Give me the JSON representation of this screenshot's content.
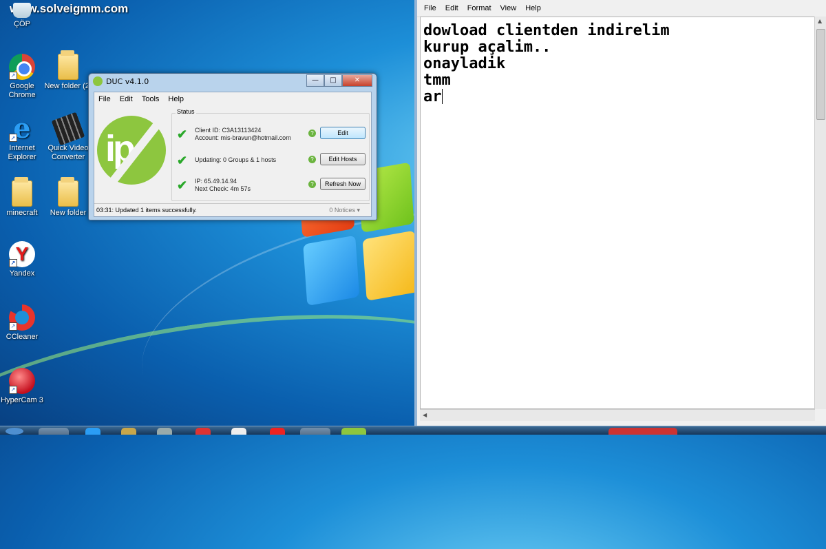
{
  "watermark": "www.solveigmm.com",
  "desktop": {
    "icons": [
      {
        "label": "ÇÖP",
        "icon": "recycle-bin-icon"
      },
      {
        "label": "Google Chrome",
        "icon": "chrome-icon"
      },
      {
        "label": "New folder (2)",
        "icon": "folder-icon"
      },
      {
        "label": "Internet Explorer",
        "icon": "internet-explorer-icon"
      },
      {
        "label": "Quick Video Converter",
        "icon": "film-icon"
      },
      {
        "label": "minecraft",
        "icon": "folder-icon"
      },
      {
        "label": "New folder",
        "icon": "folder-icon"
      },
      {
        "label": "Yandex",
        "icon": "yandex-icon"
      },
      {
        "label": "CCleaner",
        "icon": "ccleaner-icon"
      },
      {
        "label": "HyperCam 3",
        "icon": "hypercam-icon"
      }
    ]
  },
  "duc": {
    "title": "DUC v4.1.0",
    "menu": [
      "File",
      "Edit",
      "Tools",
      "Help"
    ],
    "status_label": "Status",
    "logo_text": "ip",
    "rows": [
      {
        "line1": "Client ID: C3A13113424",
        "line2": "Account: mis-bravun@hotmail.com",
        "button": "Edit"
      },
      {
        "line1": "Updating: 0 Groups & 1 hosts",
        "line2": "",
        "button": "Edit Hosts"
      },
      {
        "line1": "IP: 65.49.14.94",
        "line2": "Next Check: 4m 57s",
        "button": "Refresh Now"
      }
    ],
    "statusbar_left": "03:31: Updated 1 items successfully.",
    "statusbar_right": "0 Notices",
    "accent_color": "#8dc63f"
  },
  "notepad": {
    "menu": [
      "File",
      "Edit",
      "Format",
      "View",
      "Help"
    ],
    "lines": [
      "dowload clientden indirelim",
      "kurup açalim..",
      "onayladik",
      "tmm",
      "ar"
    ]
  }
}
